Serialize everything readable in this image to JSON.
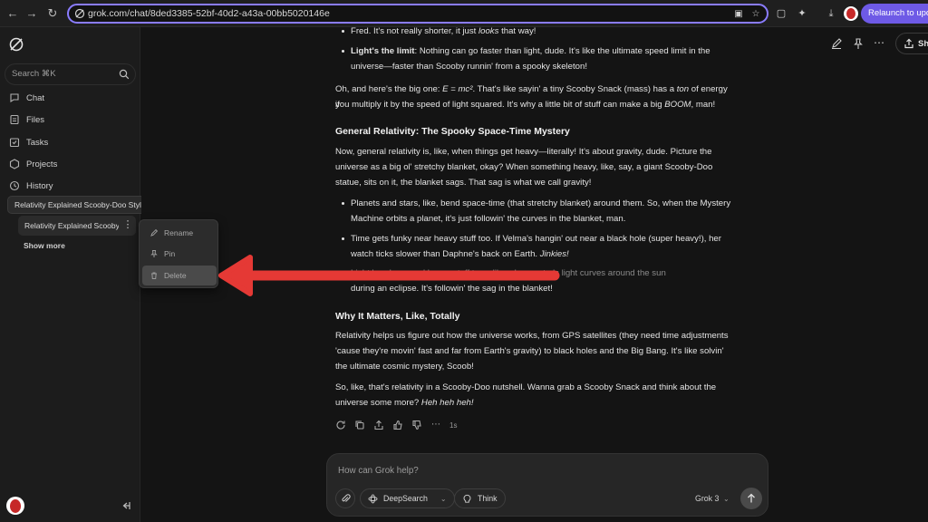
{
  "browser": {
    "url": "grok.com/chat/8ded3385-52bf-40d2-a43a-00bb5020146e",
    "relaunch_label": "Relaunch to upda",
    "accent": "#6e5ae6"
  },
  "sidebar": {
    "search_placeholder": "Search ⌘K",
    "nav": [
      "Chat",
      "Files",
      "Tasks",
      "Projects",
      "History"
    ],
    "tooltip": "Relativity Explained Scooby-Doo Style",
    "history_item": "Relativity Explained Scooby-Doo Style",
    "show_more": "Show more"
  },
  "context_menu": {
    "items": [
      "Rename",
      "Pin",
      "Delete"
    ],
    "highlighted": "Delete"
  },
  "header": {
    "share_label": "Share"
  },
  "content": {
    "top_line": "Fred. It's not really shorter, it just looks that way!",
    "top_line_pre": "Fred. It's not really shorter, it just ",
    "top_line_em": "looks",
    "top_line_post": " that way!",
    "bullet_light_title": "Light's the limit",
    "bullet_light_l1": ": Nothing can go faster than light, dude. It's like the ultimate speed limit in the",
    "bullet_light_l2": "universe—faster than Scooby runnin' from a spooky skeleton!",
    "emc2_l1_pre": "Oh, and here's the big one: ",
    "emc2_formula": "E = mc²",
    "emc2_l1_mid": ". That's like sayin' a tiny Scooby Snack (mass) has a ",
    "emc2_l1_em": "ton",
    "emc2_l1_post": " of energy if",
    "emc2_l2_pre": "you multiply it by the speed of light squared. It's why a little bit of stuff can make a big ",
    "emc2_l2_em": "BOOM",
    "emc2_l2_post": ", man!",
    "gr_heading": "General Relativity: The Spooky Space-Time Mystery",
    "gr_p_l1": "Now, general relativity is, like, when things get heavy—literally! It's about gravity, dude. Picture the",
    "gr_p_l2": "universe as a big ol' stretchy blanket, okay? When something heavy, like, say, a giant Scooby-Doo",
    "gr_p_l3": "statue, sits on it, the blanket sags. That sag is what we call gravity!",
    "gr_b1_l1": "Planets and stars, like, bend space-time (that stretchy blanket) around them. So, when the Mystery",
    "gr_b1_l2": "Machine orbits a planet, it's just followin' the curves in the blanket, man.",
    "gr_b2_l1": "Time gets funky near heavy stuff too. If Velma's hangin' out near a black hole (super heavy!), her",
    "gr_b2_l2_pre": "watch ticks slower than Daphne's back on Earth. ",
    "gr_b2_l2_em": "Jinkies!",
    "gr_b3_l1": "Light bends around heavy stuff too—like when a star's light curves around the sun",
    "gr_b3_l2": "during an eclipse. It's followin' the sag in the blanket!",
    "why_heading": "Why It Matters, Like, Totally",
    "why_l1": "Relativity helps us figure out how the universe works, from GPS satellites (they need time adjustments",
    "why_l2": "'cause they're movin' fast and far from Earth's gravity) to black holes and the Big Bang. It's like solvin'",
    "why_l3": "the ultimate cosmic mystery, Scoob!",
    "close_l1": "So, like, that's relativity in a Scooby-Doo nutshell. Wanna grab a Scooby Snack and think about the",
    "close_l2_pre": "universe some more? ",
    "close_l2_em": "Heh heh heh!"
  },
  "actions": {
    "time": "1s"
  },
  "composer": {
    "placeholder": "How can Grok help?",
    "deepsearch_label": "DeepSearch",
    "think_label": "Think",
    "model_label": "Grok 3"
  },
  "annotation": {
    "arrow_color": "#e53935"
  }
}
